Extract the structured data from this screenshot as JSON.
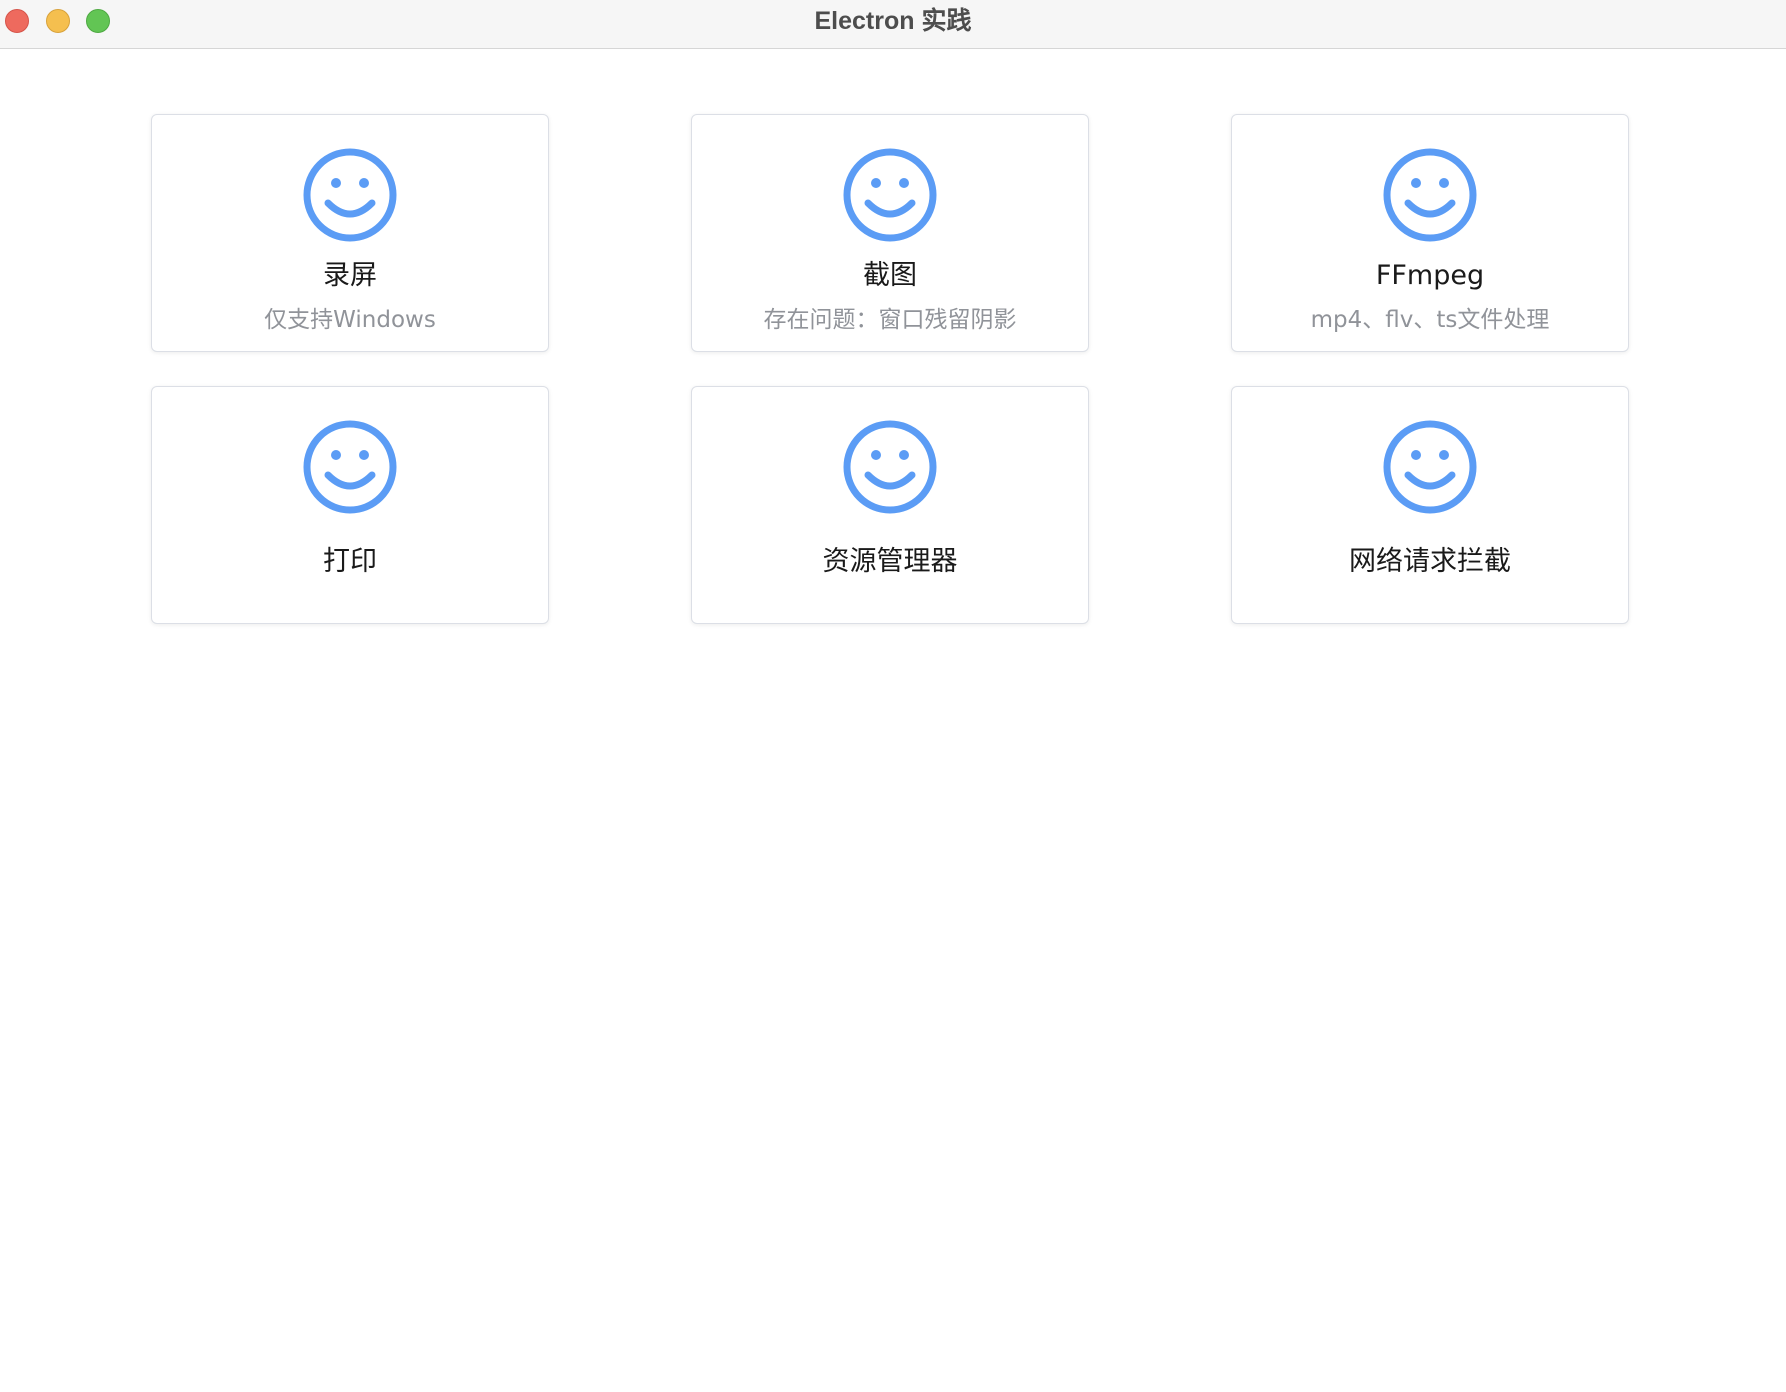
{
  "window": {
    "title": "Electron 实践",
    "controls": [
      "close",
      "minimize",
      "maximize"
    ]
  },
  "accent_color": "#5b9cf5",
  "cards": [
    {
      "title": "录屏",
      "subtitle": "仅支持Windows",
      "icon": "smile-icon"
    },
    {
      "title": "截图",
      "subtitle": "存在问题：窗口残留阴影",
      "icon": "smile-icon"
    },
    {
      "title": "FFmpeg",
      "subtitle": "mp4、flv、ts文件处理",
      "icon": "smile-icon"
    },
    {
      "title": "打印",
      "subtitle": "",
      "icon": "smile-icon"
    },
    {
      "title": "资源管理器",
      "subtitle": "",
      "icon": "smile-icon"
    },
    {
      "title": "网络请求拦截",
      "subtitle": "",
      "icon": "smile-icon"
    }
  ]
}
